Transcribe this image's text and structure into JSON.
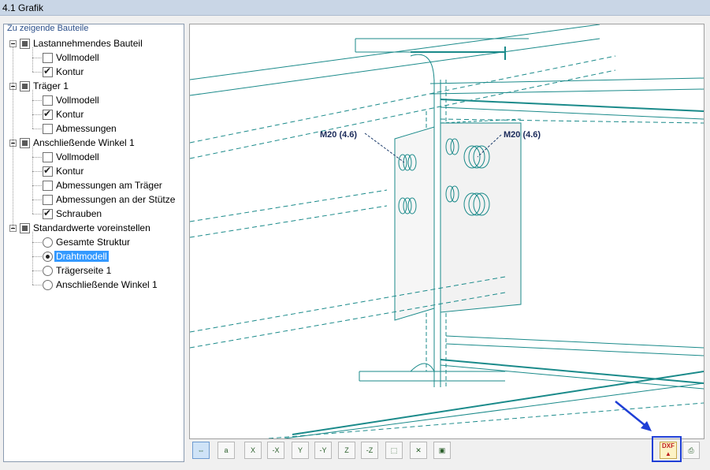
{
  "window": {
    "title": "4.1 Grafik"
  },
  "tree": {
    "header": "Zu zeigende Bauteile",
    "items": [
      {
        "label": "Lastannehmendes Bauteil",
        "kind": "group",
        "state": "partial"
      },
      {
        "label": "Vollmodell",
        "kind": "checkbox",
        "checked": false
      },
      {
        "label": "Kontur",
        "kind": "checkbox",
        "checked": true
      },
      {
        "label": "Träger 1",
        "kind": "group",
        "state": "partial"
      },
      {
        "label": "Vollmodell",
        "kind": "checkbox",
        "checked": false
      },
      {
        "label": "Kontur",
        "kind": "checkbox",
        "checked": true
      },
      {
        "label": "Abmessungen",
        "kind": "checkbox",
        "checked": false
      },
      {
        "label": "Anschließende Winkel  1",
        "kind": "group",
        "state": "partial"
      },
      {
        "label": "Vollmodell",
        "kind": "checkbox",
        "checked": false
      },
      {
        "label": "Kontur",
        "kind": "checkbox",
        "checked": true
      },
      {
        "label": "Abmessungen am Träger",
        "kind": "checkbox",
        "checked": false
      },
      {
        "label": "Abmessungen an der Stütze",
        "kind": "checkbox",
        "checked": false
      },
      {
        "label": "Schrauben",
        "kind": "checkbox",
        "checked": true
      },
      {
        "label": "Standardwerte voreinstellen",
        "kind": "group",
        "state": "partial"
      },
      {
        "label": "Gesamte Struktur",
        "kind": "radio",
        "checked": false
      },
      {
        "label": "Drahtmodell",
        "kind": "radio",
        "checked": true,
        "selected": true
      },
      {
        "label": "Trägerseite 1",
        "kind": "radio",
        "checked": false
      },
      {
        "label": "Anschließende Winkel  1",
        "kind": "radio",
        "checked": false
      }
    ]
  },
  "view": {
    "bolt_label_left": "M20 (4.6)",
    "bolt_label_right": "M20 (4.6)",
    "line_color": "#1a8a8a"
  },
  "toolbar": {
    "buttons": [
      "X",
      "a",
      "X",
      "-X",
      "Y",
      "-Y",
      "Z",
      "-Z",
      "box",
      "select",
      "layers"
    ],
    "dxf_label": "DXF"
  }
}
